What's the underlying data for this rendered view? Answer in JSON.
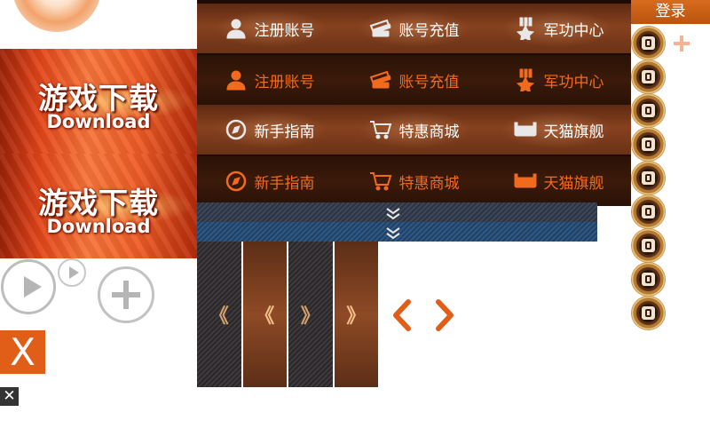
{
  "banners": [
    {
      "title_cn": "游戏下载",
      "title_en": "Download"
    },
    {
      "title_cn": "游戏下载",
      "title_en": "Download"
    }
  ],
  "close": {
    "big": "X",
    "small": "✕"
  },
  "login": {
    "label": "登录"
  },
  "menu": {
    "rows": [
      {
        "style": "light",
        "items": [
          {
            "label": "注册账号",
            "icon": "user-icon"
          },
          {
            "label": "账号充值",
            "icon": "card-icon"
          },
          {
            "label": "军功中心",
            "icon": "medal-star-icon"
          }
        ]
      },
      {
        "style": "dark",
        "items": [
          {
            "label": "注册账号",
            "icon": "user-icon"
          },
          {
            "label": "账号充值",
            "icon": "card-icon"
          },
          {
            "label": "军功中心",
            "icon": "medal-star-icon"
          }
        ]
      },
      {
        "style": "light",
        "items": [
          {
            "label": "新手指南",
            "icon": "compass-icon"
          },
          {
            "label": "特惠商城",
            "icon": "cart-icon"
          },
          {
            "label": "天猫旗舰",
            "icon": "tmall-icon"
          }
        ]
      },
      {
        "style": "dark",
        "items": [
          {
            "label": "新手指南",
            "icon": "compass-icon"
          },
          {
            "label": "特惠商城",
            "icon": "cart-icon"
          },
          {
            "label": "天猫旗舰",
            "icon": "tmall-icon"
          }
        ]
      }
    ]
  },
  "pager": {
    "labels": [
      "《",
      "《",
      "》",
      "》"
    ]
  },
  "colors": {
    "accent": "#e05e17",
    "menu_dark_text": "#f26a1d",
    "menu_bg": "#1e0b03"
  },
  "medals": [
    "link-icon",
    "tag-icon",
    "sword-icon",
    "headset-icon",
    "grid-icon",
    "helmet-icon",
    "clapper-icon",
    "film-reel-icon",
    "list-icon"
  ]
}
